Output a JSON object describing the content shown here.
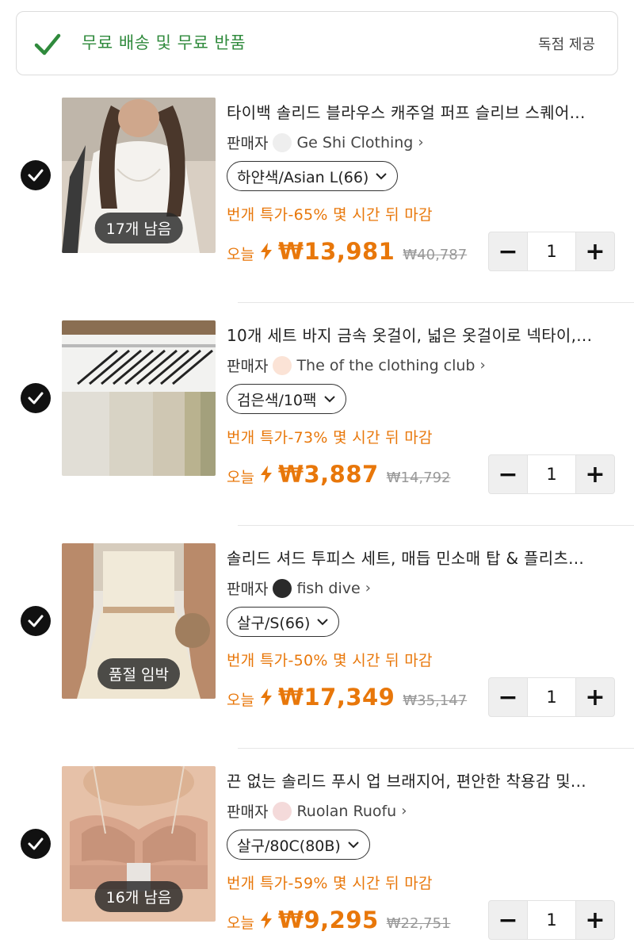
{
  "banner": {
    "title": "무료 배송 및 무료 반품",
    "right": "독점 제공",
    "accent": "#2f8a3c"
  },
  "colors": {
    "price": "#e8770a",
    "strike": "#999999",
    "check": "#111111"
  },
  "items": [
    {
      "title": "타이백 솔리드 블라우스 캐주얼 퍼프 슬리브 스퀘어...",
      "seller_label": "판매자",
      "seller_name": "Ge Shi Clothing",
      "variant": "하얀색/Asian L(66)",
      "flash": "번개 특가-65% 몇 시간 뒤 마감",
      "today": "오늘",
      "price": "₩13,981",
      "original_price": "₩40,787",
      "quantity": "1",
      "badge": "17개 남음",
      "selected": true
    },
    {
      "title": "10개 세트 바지 금속 옷걸이, 넓은 옷걸이로 넥타이,...",
      "seller_label": "판매자",
      "seller_name": "The of the clothing club",
      "variant": "검은색/10팩",
      "flash": "번개 특가-73% 몇 시간 뒤 마감",
      "today": "오늘",
      "price": "₩3,887",
      "original_price": "₩14,792",
      "quantity": "1",
      "badge": "",
      "selected": true
    },
    {
      "title": "솔리드 셔드 투피스 세트, 매듭 민소매 탑 & 플리츠...",
      "seller_label": "판매자",
      "seller_name": "fish dive",
      "variant": "살구/S(66)",
      "flash": "번개 특가-50% 몇 시간 뒤 마감",
      "today": "오늘",
      "price": "₩17,349",
      "original_price": "₩35,147",
      "quantity": "1",
      "badge": "품절 임박",
      "selected": true
    },
    {
      "title": "끈 없는 솔리드 푸시 업 브래지어, 편안한 착용감 및...",
      "seller_label": "판매자",
      "seller_name": "Ruolan Ruofu",
      "variant": "살구/80C(80B)",
      "flash": "번개 특가-59% 몇 시간 뒤 마감",
      "today": "오늘",
      "price": "₩9,295",
      "original_price": "₩22,751",
      "quantity": "1",
      "badge": "16개 남음",
      "selected": true
    }
  ]
}
